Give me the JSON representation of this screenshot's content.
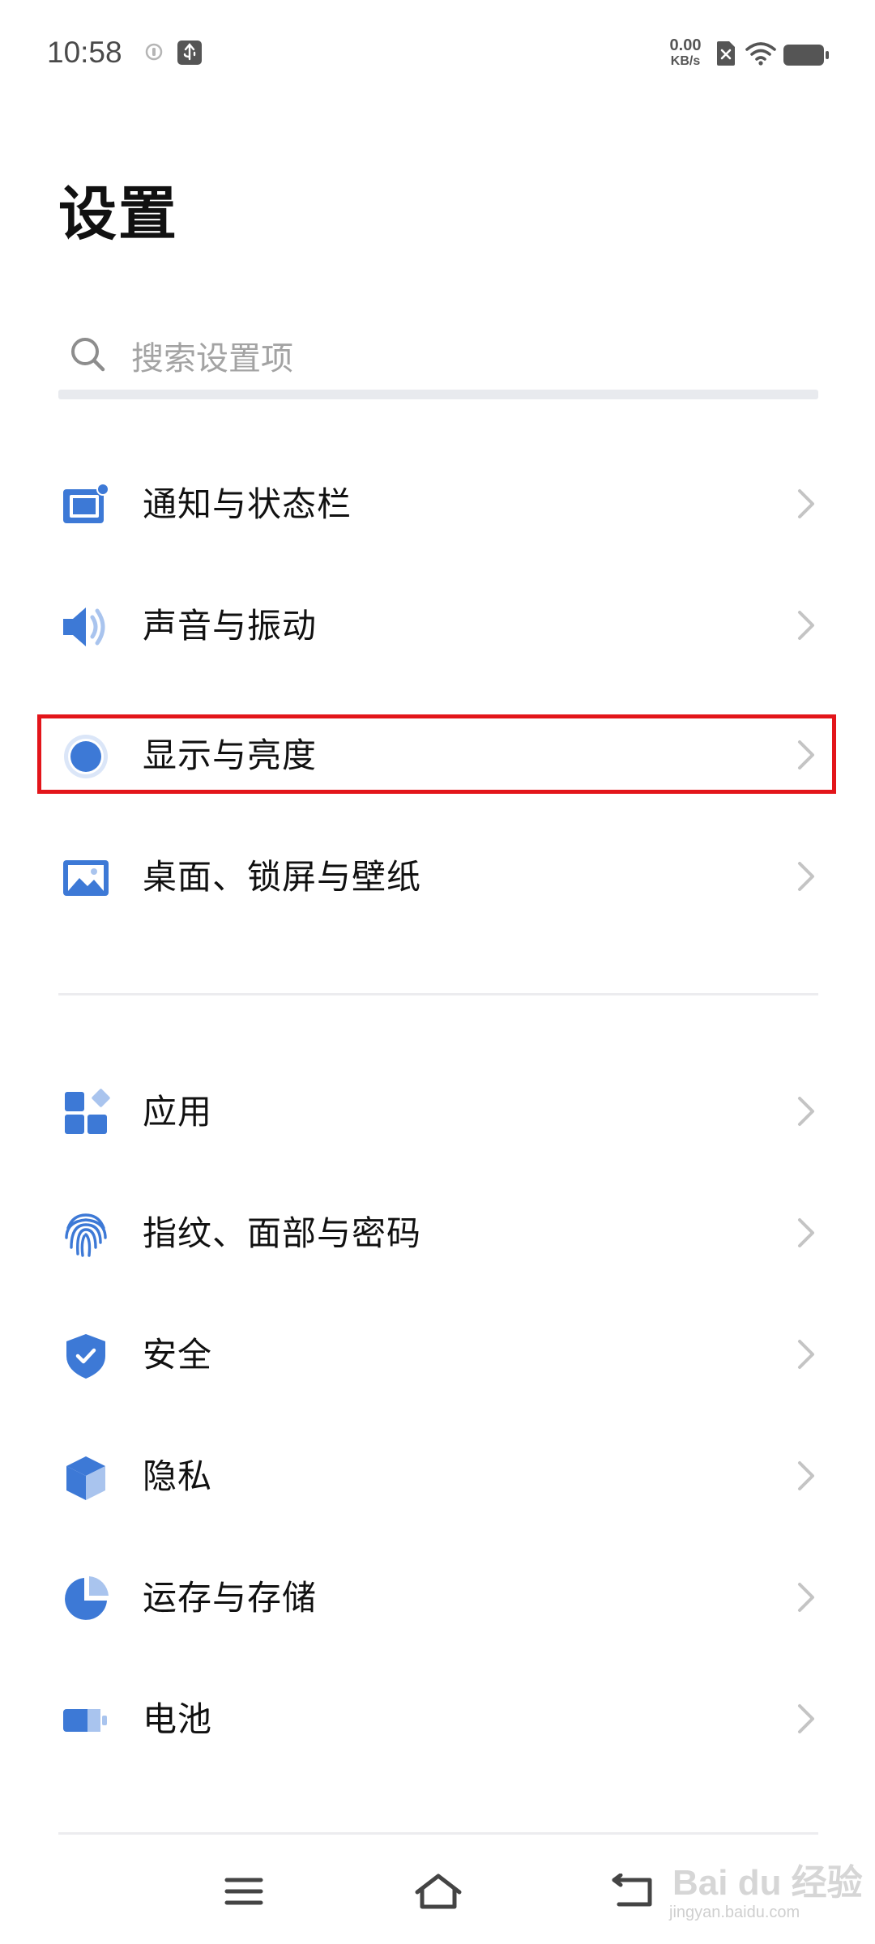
{
  "status_bar": {
    "time": "10:58",
    "net_speed_value": "0.00",
    "net_speed_unit": "KB/s",
    "icons": [
      "notification-dot-icon",
      "usb-debug-icon",
      "no-sim-icon",
      "wifi-icon",
      "battery-icon"
    ]
  },
  "page": {
    "title": "设置"
  },
  "search": {
    "placeholder": "搜索设置项",
    "value": ""
  },
  "settings_groups": [
    {
      "items": [
        {
          "label": "通知与状态栏",
          "icon": "notification-statusbar-icon"
        },
        {
          "label": "声音与振动",
          "icon": "speaker-icon"
        },
        {
          "label": "显示与亮度",
          "icon": "display-brightness-icon",
          "highlighted": true
        },
        {
          "label": "桌面、锁屏与壁纸",
          "icon": "wallpaper-icon"
        }
      ]
    },
    {
      "items": [
        {
          "label": "应用",
          "icon": "apps-icon"
        },
        {
          "label": "指纹、面部与密码",
          "icon": "fingerprint-icon"
        },
        {
          "label": "安全",
          "icon": "shield-icon"
        },
        {
          "label": "隐私",
          "icon": "privacy-cube-icon"
        },
        {
          "label": "运存与存储",
          "icon": "storage-pie-icon"
        },
        {
          "label": "电池",
          "icon": "battery-settings-icon"
        }
      ]
    }
  ],
  "nav_bar": {
    "buttons": [
      "menu-icon",
      "home-icon",
      "back-icon"
    ]
  },
  "watermark": {
    "brand": "Bai du 经验",
    "url": "jingyan.baidu.com"
  },
  "colors": {
    "accent_blue": "#3d79d6",
    "light_blue": "#a9c4ee",
    "highlight_red": "#e3151a",
    "chevron_gray": "#c4c4c4"
  }
}
